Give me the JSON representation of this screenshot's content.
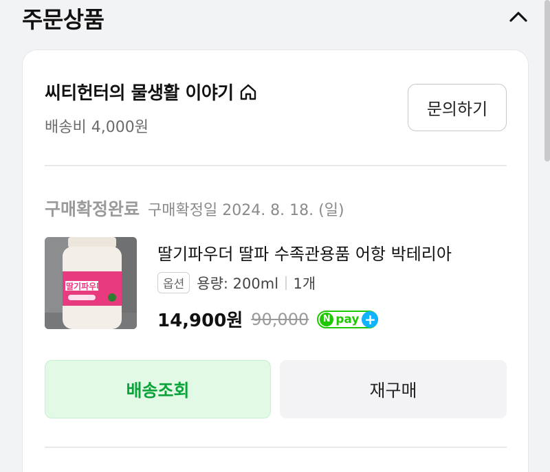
{
  "section": {
    "title": "주문상품"
  },
  "seller": {
    "name": "씨티헌터의 물생활 이야기",
    "shipping_fee": "배송비 4,000원"
  },
  "inquiry_button": "문의하기",
  "order": {
    "status": "구매확정완료",
    "confirm_date": "구매확정일 2024. 8. 18. (일)"
  },
  "product": {
    "title": "딸기파우더 딸파 수족관용품 어항 박테리아",
    "option_badge": "옵션",
    "option_value": "용량: 200ml",
    "quantity": "1개",
    "price": "14,900원",
    "original_price": "90,000",
    "thumb_label": "딸기파우더",
    "npay_n": "N",
    "npay_text": "pay",
    "npay_plus": "+"
  },
  "actions": {
    "track": "배송조회",
    "reorder": "재구매"
  },
  "icons": {
    "collapse": "chevron-up-icon",
    "store": "home-icon"
  },
  "colors": {
    "track_bg": "#e2f9e6",
    "track_text": "#0aa33a",
    "npay_green": "#1ec800",
    "npay_blue": "#12b3ff"
  }
}
